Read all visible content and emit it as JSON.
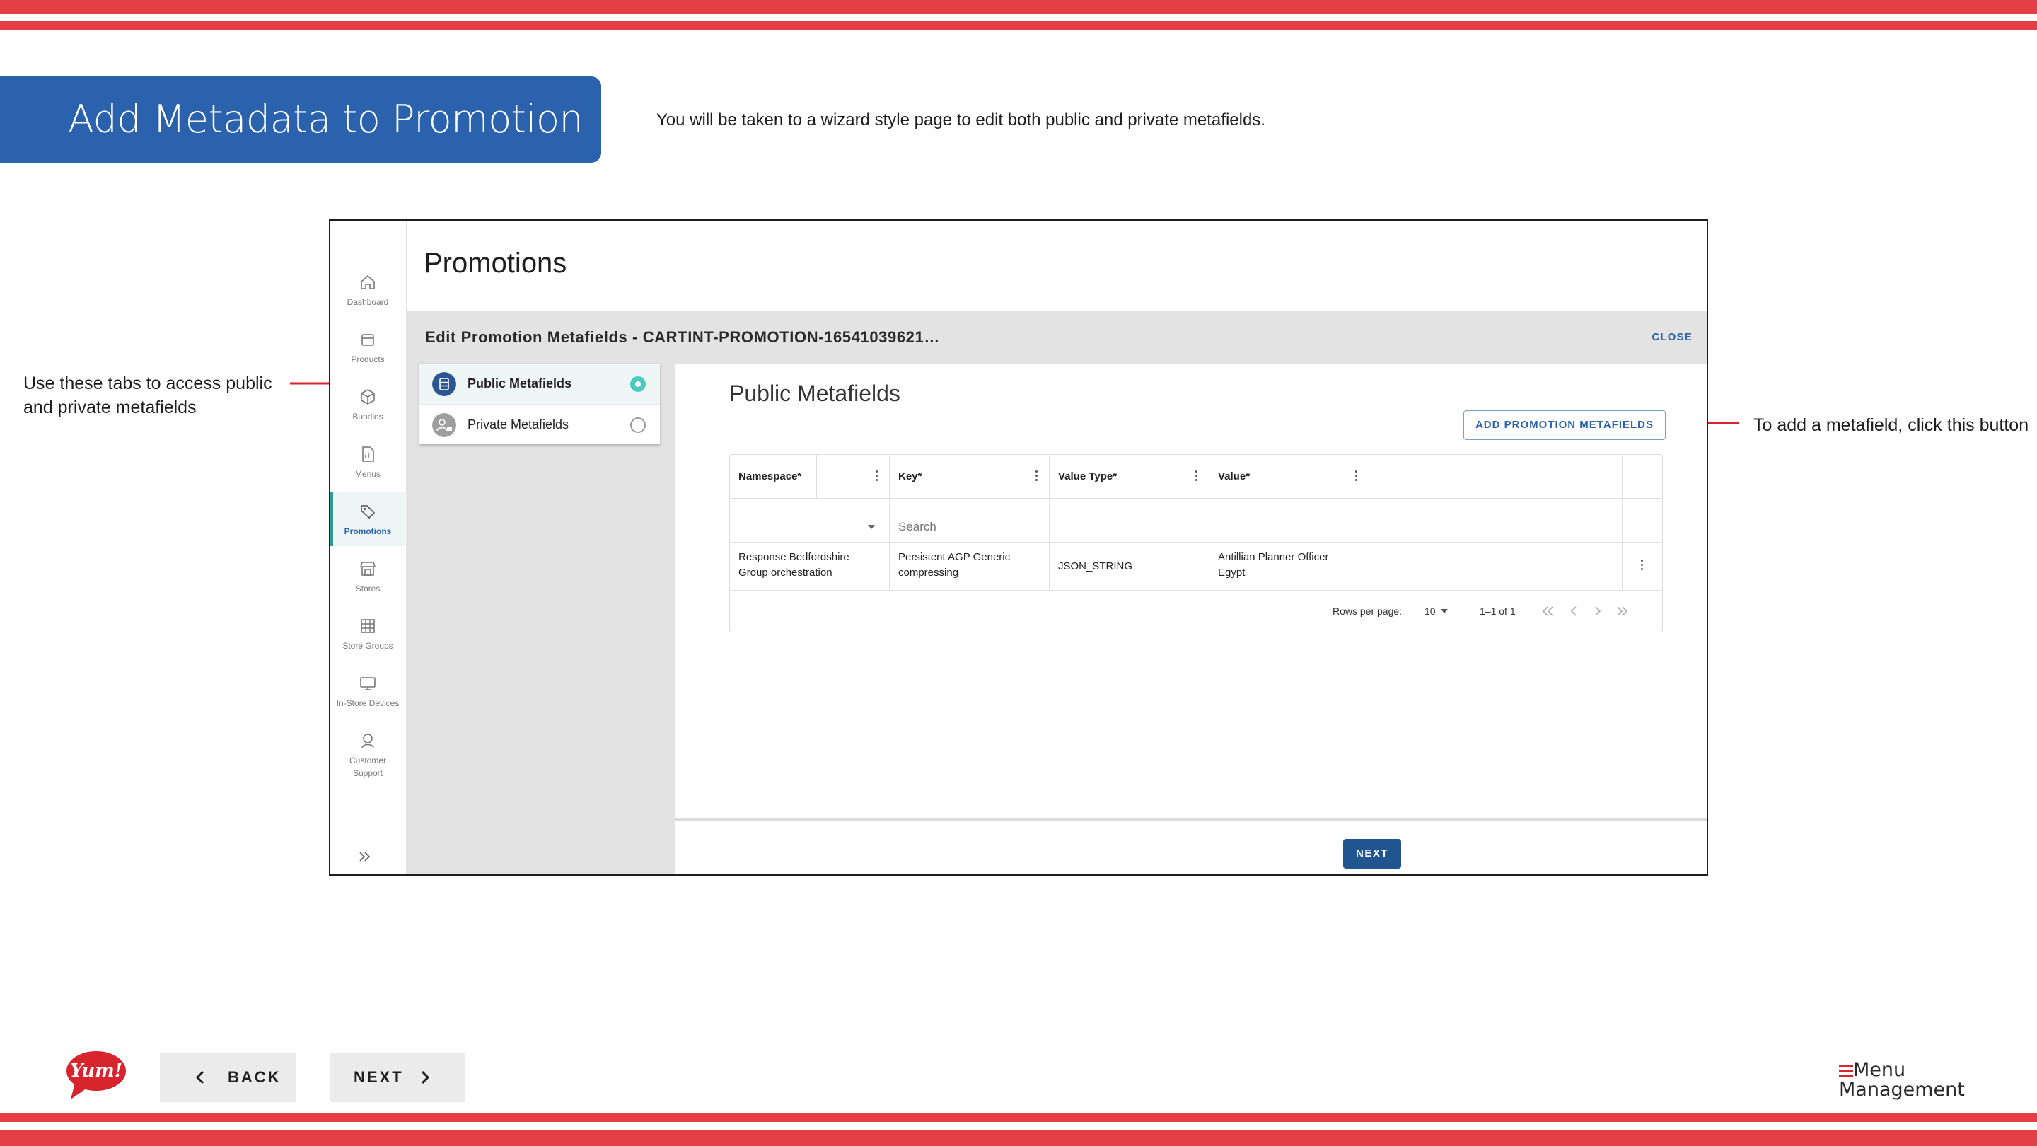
{
  "slide": {
    "title": "Add Metadata to Promotion",
    "subtitle": "You will be taken to a wizard style page to edit both public and private metafields.",
    "note_tabs": "Use these tabs to access public and private metafields",
    "note_button": "To add a metafield, click this button"
  },
  "rail": {
    "items": [
      {
        "label": "Dashboard",
        "icon": "home-icon"
      },
      {
        "label": "Products",
        "icon": "box-icon"
      },
      {
        "label": "Bundles",
        "icon": "cube-icon"
      },
      {
        "label": "Menus",
        "icon": "document-icon"
      },
      {
        "label": "Promotions",
        "icon": "tag-icon"
      },
      {
        "label": "Stores",
        "icon": "storefront-icon"
      },
      {
        "label": "Store Groups",
        "icon": "grid-icon"
      },
      {
        "label": "In-Store Devices",
        "icon": "monitor-icon"
      },
      {
        "label": "Customer Support",
        "icon": "headset-icon"
      }
    ],
    "active": "Promotions",
    "expand_icon": "double-chevron-right-icon"
  },
  "app": {
    "page_title": "Promotions",
    "modal_title": "Edit Promotion Metafields - CARTINT-PROMOTION-16541039621…",
    "close_label": "CLOSE",
    "steps": [
      {
        "label": "Public Metafields",
        "state": "selected"
      },
      {
        "label": "Private Metafields",
        "state": "unselected"
      }
    ],
    "section_title": "Public Metafields",
    "add_button": "ADD PROMOTION METAFIELDS",
    "next_label": "NEXT"
  },
  "grid": {
    "columns": [
      "Namespace*",
      "Key*",
      "Value Type*",
      "Value*"
    ],
    "search_placeholder": "Search",
    "rows": [
      {
        "namespace_line1": "Response Bedfordshire",
        "namespace_line2": "Group orchestration",
        "key_line1": "Persistent AGP Generic",
        "key_line2": "compressing",
        "value_type": "JSON_STRING",
        "value_line1": "Antillian Planner Officer",
        "value_line2": "Egypt"
      }
    ],
    "rows_per_page_label": "Rows per page:",
    "rows_per_page_value": "10",
    "range": "1–1 of 1"
  },
  "nav": {
    "back": "BACK",
    "next": "NEXT",
    "brand_logo_text": "Yum!",
    "brand_line1": "Menu",
    "brand_line2": "Management"
  },
  "colors": {
    "accent_red": "#e53e44",
    "title_blue": "#2b62ad",
    "teal": "#2d9c95"
  }
}
